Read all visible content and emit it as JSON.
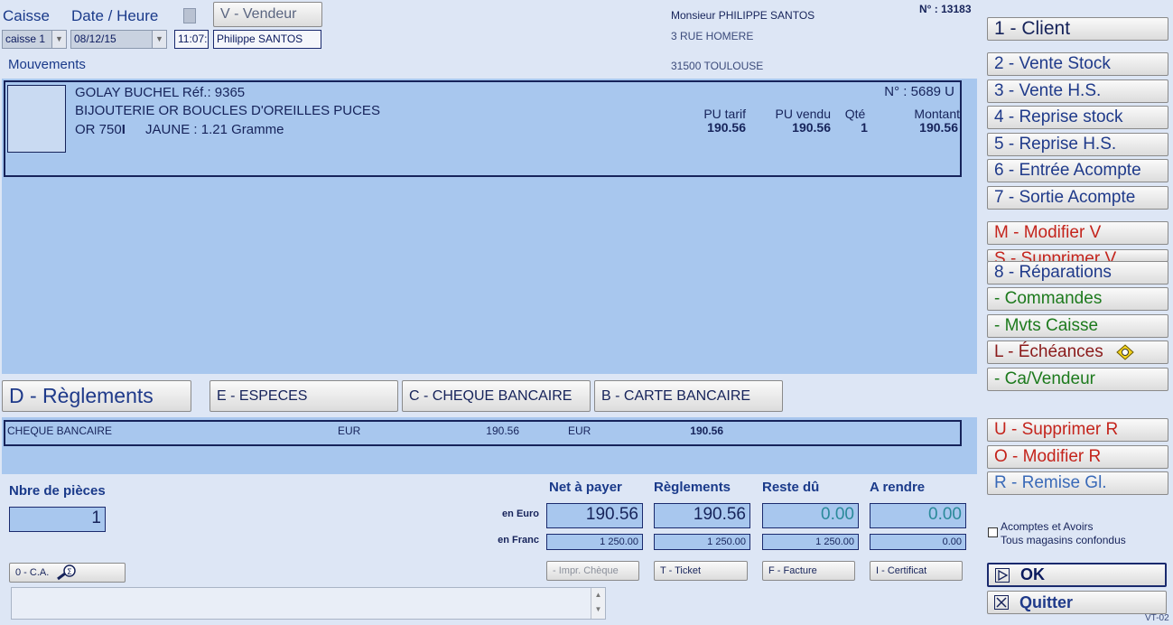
{
  "header": {
    "caisse_label": "Caisse",
    "date_label": "Date / Heure",
    "caisse_value": "caisse 1",
    "date_value": "08/12/15",
    "time_value": "11:07:",
    "vendeur_button": "V - Vendeur",
    "vendeur_value": "Philippe SANTOS",
    "client_name": "Monsieur PHILIPPE SANTOS",
    "client_address": "3 RUE HOMERE",
    "client_city": "31500 TOULOUSE",
    "ticket_number": "N° : 13183"
  },
  "mouvements": {
    "title": "Mouvements",
    "item": {
      "line1": "GOLAY BUCHEL Réf.: 9365",
      "line2": "BIJOUTERIE OR BOUCLES D'OREILLES PUCES",
      "line3_a": "OR 750",
      "line3_b": "JAUNE : 1.21 Gramme",
      "number": "N° : 5689 U",
      "cols": {
        "pu_tarif_label": "PU tarif",
        "pu_tarif": "190.56",
        "pu_vendu_label": "PU vendu",
        "pu_vendu": "190.56",
        "qte_label": "Qté",
        "qte": "1",
        "montant_label": "Montant",
        "montant": "190.56"
      }
    }
  },
  "reglements": {
    "title": "D - Règlements",
    "buttons": [
      "E - ESPECES",
      "C - CHEQUE BANCAIRE",
      "B - CARTE BANCAIRE"
    ],
    "row": {
      "type": "CHEQUE BANCAIRE",
      "cur1": "EUR",
      "amount1": "190.56",
      "cur2": "EUR",
      "amount2": "190.56"
    }
  },
  "totals": {
    "pieces_label": "Nbre de pièces",
    "pieces_value": "1",
    "headers": [
      "Net à payer",
      "Règlements",
      "Reste dû",
      "A rendre"
    ],
    "euro_label": "en Euro",
    "franc_label": "en Franc",
    "euro": [
      "190.56",
      "190.56",
      "0.00",
      "0.00"
    ],
    "franc": [
      "1 250.00",
      "1 250.00",
      "1 250.00",
      "0.00"
    ]
  },
  "bottom": {
    "ca_button": "0 - C.A.",
    "impr_cheque": "- Impr. Chèque",
    "ticket": "T - Ticket",
    "facture": "F - Facture",
    "certificat": "I - Certificat",
    "acomptes_line1": "Acomptes et Avoirs",
    "acomptes_line2": "Tous magasins confondus",
    "ok": "OK",
    "quitter": "Quitter",
    "screen_code": "VT-02"
  },
  "right_menu": {
    "client": "1 - Client",
    "vente_stock": "2 - Vente Stock",
    "vente_hs": "3 - Vente H.S.",
    "reprise_stock": "4 - Reprise stock",
    "reprise_hs": "5 - Reprise H.S.",
    "entree_acompte": "6 - Entrée Acompte",
    "sortie_acompte": "7 - Sortie Acompte",
    "modifier_v": "M - Modifier V",
    "supprimer_v": "S - Supprimer V",
    "reparations": "8 - Réparations",
    "commandes": " - Commandes",
    "mvts_caisse": " - Mvts Caisse",
    "echeances": "L - Échéances",
    "ca_vendeur": " - Ca/Vendeur",
    "supprimer_r": "U - Supprimer R",
    "modifier_r": "O - Modifier R",
    "remise_gl": "R - Remise Gl."
  },
  "colors": {
    "panel": "#a8c7ee",
    "background": "#dde6f5",
    "text_dark": "#16235a",
    "red": "#c4241c",
    "green": "#1d7a1d"
  }
}
